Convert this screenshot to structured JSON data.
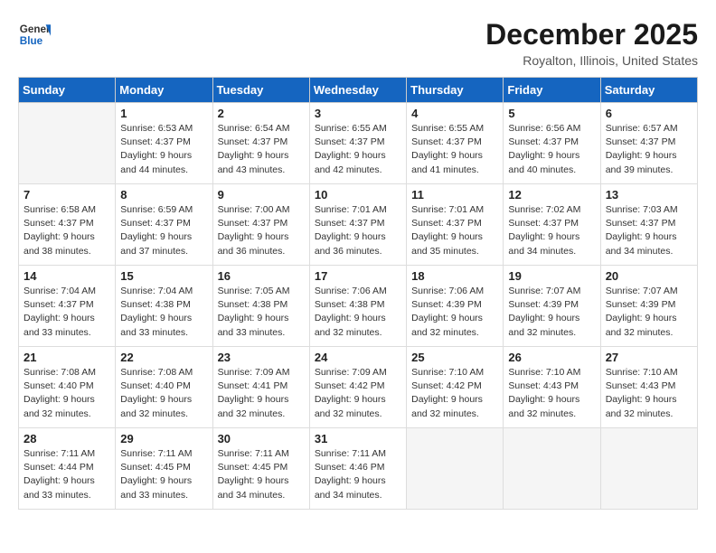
{
  "header": {
    "logo_general": "General",
    "logo_blue": "Blue",
    "month_title": "December 2025",
    "location": "Royalton, Illinois, United States"
  },
  "days_of_week": [
    "Sunday",
    "Monday",
    "Tuesday",
    "Wednesday",
    "Thursday",
    "Friday",
    "Saturday"
  ],
  "weeks": [
    [
      {
        "day": "",
        "sunrise": "",
        "sunset": "",
        "daylight": ""
      },
      {
        "day": "1",
        "sunrise": "Sunrise: 6:53 AM",
        "sunset": "Sunset: 4:37 PM",
        "daylight": "Daylight: 9 hours and 44 minutes."
      },
      {
        "day": "2",
        "sunrise": "Sunrise: 6:54 AM",
        "sunset": "Sunset: 4:37 PM",
        "daylight": "Daylight: 9 hours and 43 minutes."
      },
      {
        "day": "3",
        "sunrise": "Sunrise: 6:55 AM",
        "sunset": "Sunset: 4:37 PM",
        "daylight": "Daylight: 9 hours and 42 minutes."
      },
      {
        "day": "4",
        "sunrise": "Sunrise: 6:55 AM",
        "sunset": "Sunset: 4:37 PM",
        "daylight": "Daylight: 9 hours and 41 minutes."
      },
      {
        "day": "5",
        "sunrise": "Sunrise: 6:56 AM",
        "sunset": "Sunset: 4:37 PM",
        "daylight": "Daylight: 9 hours and 40 minutes."
      },
      {
        "day": "6",
        "sunrise": "Sunrise: 6:57 AM",
        "sunset": "Sunset: 4:37 PM",
        "daylight": "Daylight: 9 hours and 39 minutes."
      }
    ],
    [
      {
        "day": "7",
        "sunrise": "Sunrise: 6:58 AM",
        "sunset": "Sunset: 4:37 PM",
        "daylight": "Daylight: 9 hours and 38 minutes."
      },
      {
        "day": "8",
        "sunrise": "Sunrise: 6:59 AM",
        "sunset": "Sunset: 4:37 PM",
        "daylight": "Daylight: 9 hours and 37 minutes."
      },
      {
        "day": "9",
        "sunrise": "Sunrise: 7:00 AM",
        "sunset": "Sunset: 4:37 PM",
        "daylight": "Daylight: 9 hours and 36 minutes."
      },
      {
        "day": "10",
        "sunrise": "Sunrise: 7:01 AM",
        "sunset": "Sunset: 4:37 PM",
        "daylight": "Daylight: 9 hours and 36 minutes."
      },
      {
        "day": "11",
        "sunrise": "Sunrise: 7:01 AM",
        "sunset": "Sunset: 4:37 PM",
        "daylight": "Daylight: 9 hours and 35 minutes."
      },
      {
        "day": "12",
        "sunrise": "Sunrise: 7:02 AM",
        "sunset": "Sunset: 4:37 PM",
        "daylight": "Daylight: 9 hours and 34 minutes."
      },
      {
        "day": "13",
        "sunrise": "Sunrise: 7:03 AM",
        "sunset": "Sunset: 4:37 PM",
        "daylight": "Daylight: 9 hours and 34 minutes."
      }
    ],
    [
      {
        "day": "14",
        "sunrise": "Sunrise: 7:04 AM",
        "sunset": "Sunset: 4:37 PM",
        "daylight": "Daylight: 9 hours and 33 minutes."
      },
      {
        "day": "15",
        "sunrise": "Sunrise: 7:04 AM",
        "sunset": "Sunset: 4:38 PM",
        "daylight": "Daylight: 9 hours and 33 minutes."
      },
      {
        "day": "16",
        "sunrise": "Sunrise: 7:05 AM",
        "sunset": "Sunset: 4:38 PM",
        "daylight": "Daylight: 9 hours and 33 minutes."
      },
      {
        "day": "17",
        "sunrise": "Sunrise: 7:06 AM",
        "sunset": "Sunset: 4:38 PM",
        "daylight": "Daylight: 9 hours and 32 minutes."
      },
      {
        "day": "18",
        "sunrise": "Sunrise: 7:06 AM",
        "sunset": "Sunset: 4:39 PM",
        "daylight": "Daylight: 9 hours and 32 minutes."
      },
      {
        "day": "19",
        "sunrise": "Sunrise: 7:07 AM",
        "sunset": "Sunset: 4:39 PM",
        "daylight": "Daylight: 9 hours and 32 minutes."
      },
      {
        "day": "20",
        "sunrise": "Sunrise: 7:07 AM",
        "sunset": "Sunset: 4:39 PM",
        "daylight": "Daylight: 9 hours and 32 minutes."
      }
    ],
    [
      {
        "day": "21",
        "sunrise": "Sunrise: 7:08 AM",
        "sunset": "Sunset: 4:40 PM",
        "daylight": "Daylight: 9 hours and 32 minutes."
      },
      {
        "day": "22",
        "sunrise": "Sunrise: 7:08 AM",
        "sunset": "Sunset: 4:40 PM",
        "daylight": "Daylight: 9 hours and 32 minutes."
      },
      {
        "day": "23",
        "sunrise": "Sunrise: 7:09 AM",
        "sunset": "Sunset: 4:41 PM",
        "daylight": "Daylight: 9 hours and 32 minutes."
      },
      {
        "day": "24",
        "sunrise": "Sunrise: 7:09 AM",
        "sunset": "Sunset: 4:42 PM",
        "daylight": "Daylight: 9 hours and 32 minutes."
      },
      {
        "day": "25",
        "sunrise": "Sunrise: 7:10 AM",
        "sunset": "Sunset: 4:42 PM",
        "daylight": "Daylight: 9 hours and 32 minutes."
      },
      {
        "day": "26",
        "sunrise": "Sunrise: 7:10 AM",
        "sunset": "Sunset: 4:43 PM",
        "daylight": "Daylight: 9 hours and 32 minutes."
      },
      {
        "day": "27",
        "sunrise": "Sunrise: 7:10 AM",
        "sunset": "Sunset: 4:43 PM",
        "daylight": "Daylight: 9 hours and 32 minutes."
      }
    ],
    [
      {
        "day": "28",
        "sunrise": "Sunrise: 7:11 AM",
        "sunset": "Sunset: 4:44 PM",
        "daylight": "Daylight: 9 hours and 33 minutes."
      },
      {
        "day": "29",
        "sunrise": "Sunrise: 7:11 AM",
        "sunset": "Sunset: 4:45 PM",
        "daylight": "Daylight: 9 hours and 33 minutes."
      },
      {
        "day": "30",
        "sunrise": "Sunrise: 7:11 AM",
        "sunset": "Sunset: 4:45 PM",
        "daylight": "Daylight: 9 hours and 34 minutes."
      },
      {
        "day": "31",
        "sunrise": "Sunrise: 7:11 AM",
        "sunset": "Sunset: 4:46 PM",
        "daylight": "Daylight: 9 hours and 34 minutes."
      },
      {
        "day": "",
        "sunrise": "",
        "sunset": "",
        "daylight": ""
      },
      {
        "day": "",
        "sunrise": "",
        "sunset": "",
        "daylight": ""
      },
      {
        "day": "",
        "sunrise": "",
        "sunset": "",
        "daylight": ""
      }
    ]
  ]
}
